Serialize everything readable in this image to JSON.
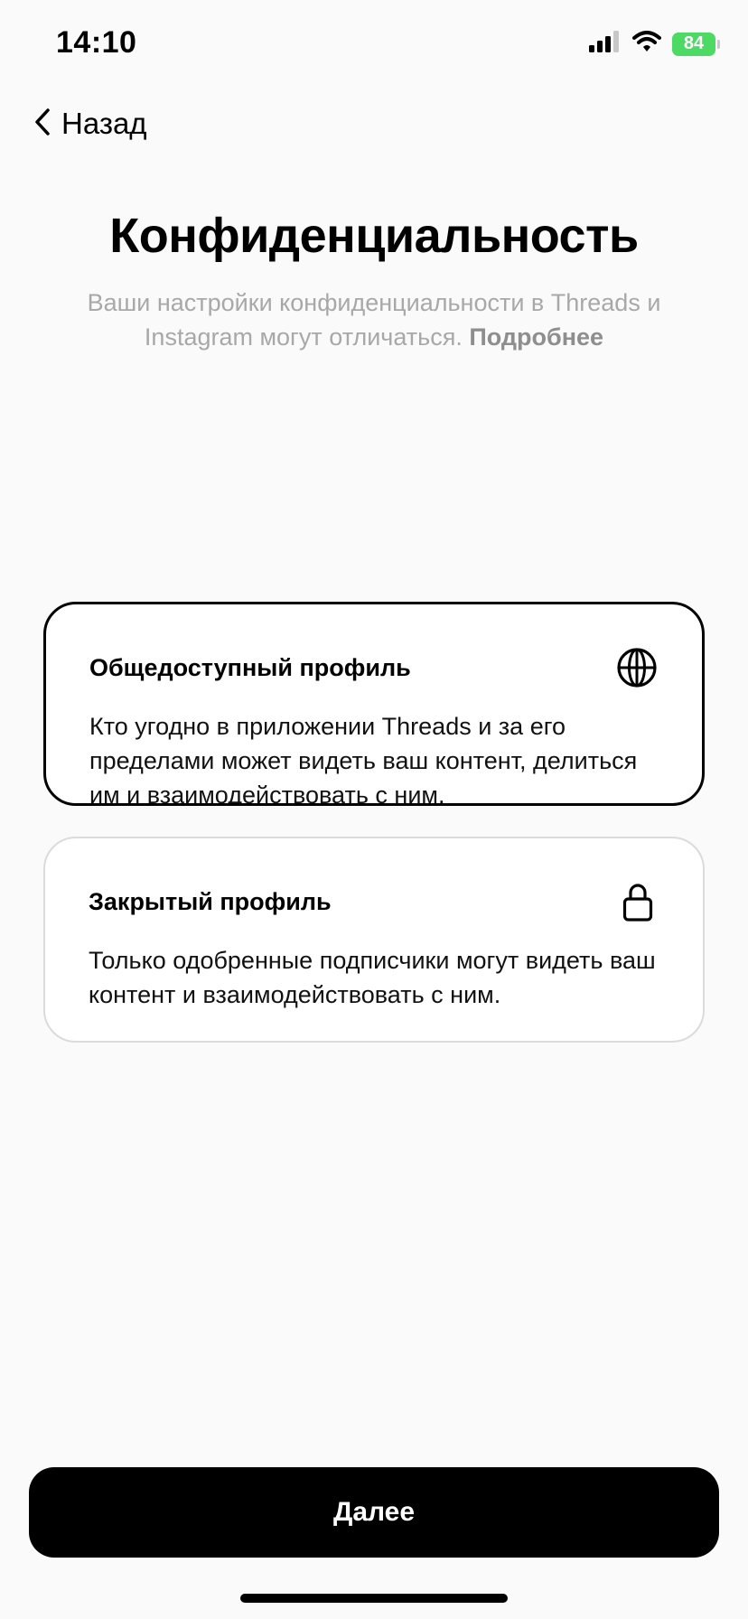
{
  "status_bar": {
    "time": "14:10",
    "battery": "84",
    "signal_icon": "cellular-signal-icon",
    "wifi_icon": "wifi-icon",
    "battery_color": "#4cd964"
  },
  "nav": {
    "back_label": "Назад",
    "back_icon": "chevron-left-icon"
  },
  "header": {
    "title": "Конфиденциальность",
    "subtitle": "Ваши настройки конфиденциальности в Threads и Instagram могут отличаться.",
    "subtitle_link": "Подробнее"
  },
  "options": [
    {
      "title": "Общедоступный профиль",
      "description": "Кто угодно в приложении Threads и за его пределами может видеть ваш контент, делиться им и взаимодействовать с ним.",
      "icon": "globe-icon",
      "selected": true
    },
    {
      "title": "Закрытый профиль",
      "description": "Только одобренные подписчики могут видеть ваш контент и взаимодействовать с ним.",
      "icon": "lock-icon",
      "selected": false
    }
  ],
  "footer": {
    "next_label": "Далее"
  }
}
